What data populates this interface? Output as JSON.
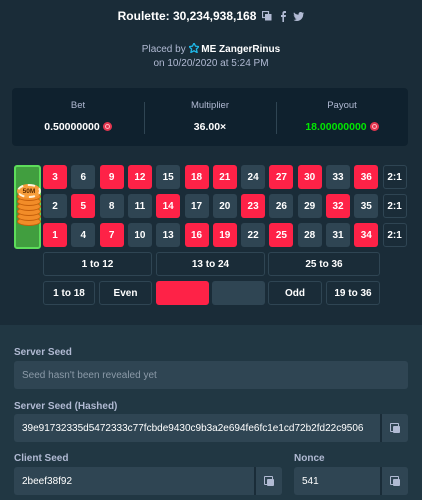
{
  "header": {
    "title": "Roulette: 30,234,938,168",
    "icons": [
      "copy-icon",
      "facebook-icon",
      "twitter-icon"
    ]
  },
  "placed": {
    "prefix": "Placed by",
    "username": "ME ZangerRinus",
    "date": "on 10/20/2020 at 5:24 PM"
  },
  "stats": {
    "bet_label": "Bet",
    "bet_value": "0.50000000",
    "multiplier_label": "Multiplier",
    "multiplier_value": "36.00×",
    "payout_label": "Payout",
    "payout_value": "18.00000000"
  },
  "board": {
    "chip_label": "50M",
    "rows": [
      [
        {
          "n": "3",
          "c": "red"
        },
        {
          "n": "6",
          "c": "black"
        },
        {
          "n": "9",
          "c": "red"
        },
        {
          "n": "12",
          "c": "red"
        },
        {
          "n": "15",
          "c": "black"
        },
        {
          "n": "18",
          "c": "red"
        },
        {
          "n": "21",
          "c": "red"
        },
        {
          "n": "24",
          "c": "black"
        },
        {
          "n": "27",
          "c": "red"
        },
        {
          "n": "30",
          "c": "red"
        },
        {
          "n": "33",
          "c": "black"
        },
        {
          "n": "36",
          "c": "red"
        },
        {
          "n": "2:1",
          "c": "col"
        }
      ],
      [
        {
          "n": "2",
          "c": "black"
        },
        {
          "n": "5",
          "c": "red"
        },
        {
          "n": "8",
          "c": "black"
        },
        {
          "n": "11",
          "c": "black"
        },
        {
          "n": "14",
          "c": "red"
        },
        {
          "n": "17",
          "c": "black"
        },
        {
          "n": "20",
          "c": "black"
        },
        {
          "n": "23",
          "c": "red"
        },
        {
          "n": "26",
          "c": "black"
        },
        {
          "n": "29",
          "c": "black"
        },
        {
          "n": "32",
          "c": "red"
        },
        {
          "n": "35",
          "c": "black"
        },
        {
          "n": "2:1",
          "c": "col"
        }
      ],
      [
        {
          "n": "1",
          "c": "red"
        },
        {
          "n": "4",
          "c": "black"
        },
        {
          "n": "7",
          "c": "red"
        },
        {
          "n": "10",
          "c": "black"
        },
        {
          "n": "13",
          "c": "black"
        },
        {
          "n": "16",
          "c": "red"
        },
        {
          "n": "19",
          "c": "red"
        },
        {
          "n": "22",
          "c": "black"
        },
        {
          "n": "25",
          "c": "red"
        },
        {
          "n": "28",
          "c": "black"
        },
        {
          "n": "31",
          "c": "black"
        },
        {
          "n": "34",
          "c": "red"
        },
        {
          "n": "2:1",
          "c": "col"
        }
      ]
    ],
    "dozens": [
      "1 to 12",
      "13 to 24",
      "25 to 36"
    ],
    "outside": [
      "1 to 18",
      "Even",
      "",
      "",
      "Odd",
      "19 to 36"
    ]
  },
  "fairness": {
    "server_seed_label": "Server Seed",
    "server_seed_placeholder": "Seed hasn't been revealed yet",
    "server_seed_hashed_label": "Server Seed (Hashed)",
    "server_seed_hashed_value": "39e91732335d5472333c77fcbde9430c9b3a2e694fe6fc1e1cd72b2fd22c9506",
    "client_seed_label": "Client Seed",
    "client_seed_value": "2beef38f92",
    "nonce_label": "Nonce",
    "nonce_value": "541"
  },
  "colors": {
    "background": "#1a2c38",
    "panel": "#0f212e",
    "red": "#fe2247",
    "black": "#2f4553",
    "green": "#419e3f",
    "payout_green": "#00e701"
  }
}
